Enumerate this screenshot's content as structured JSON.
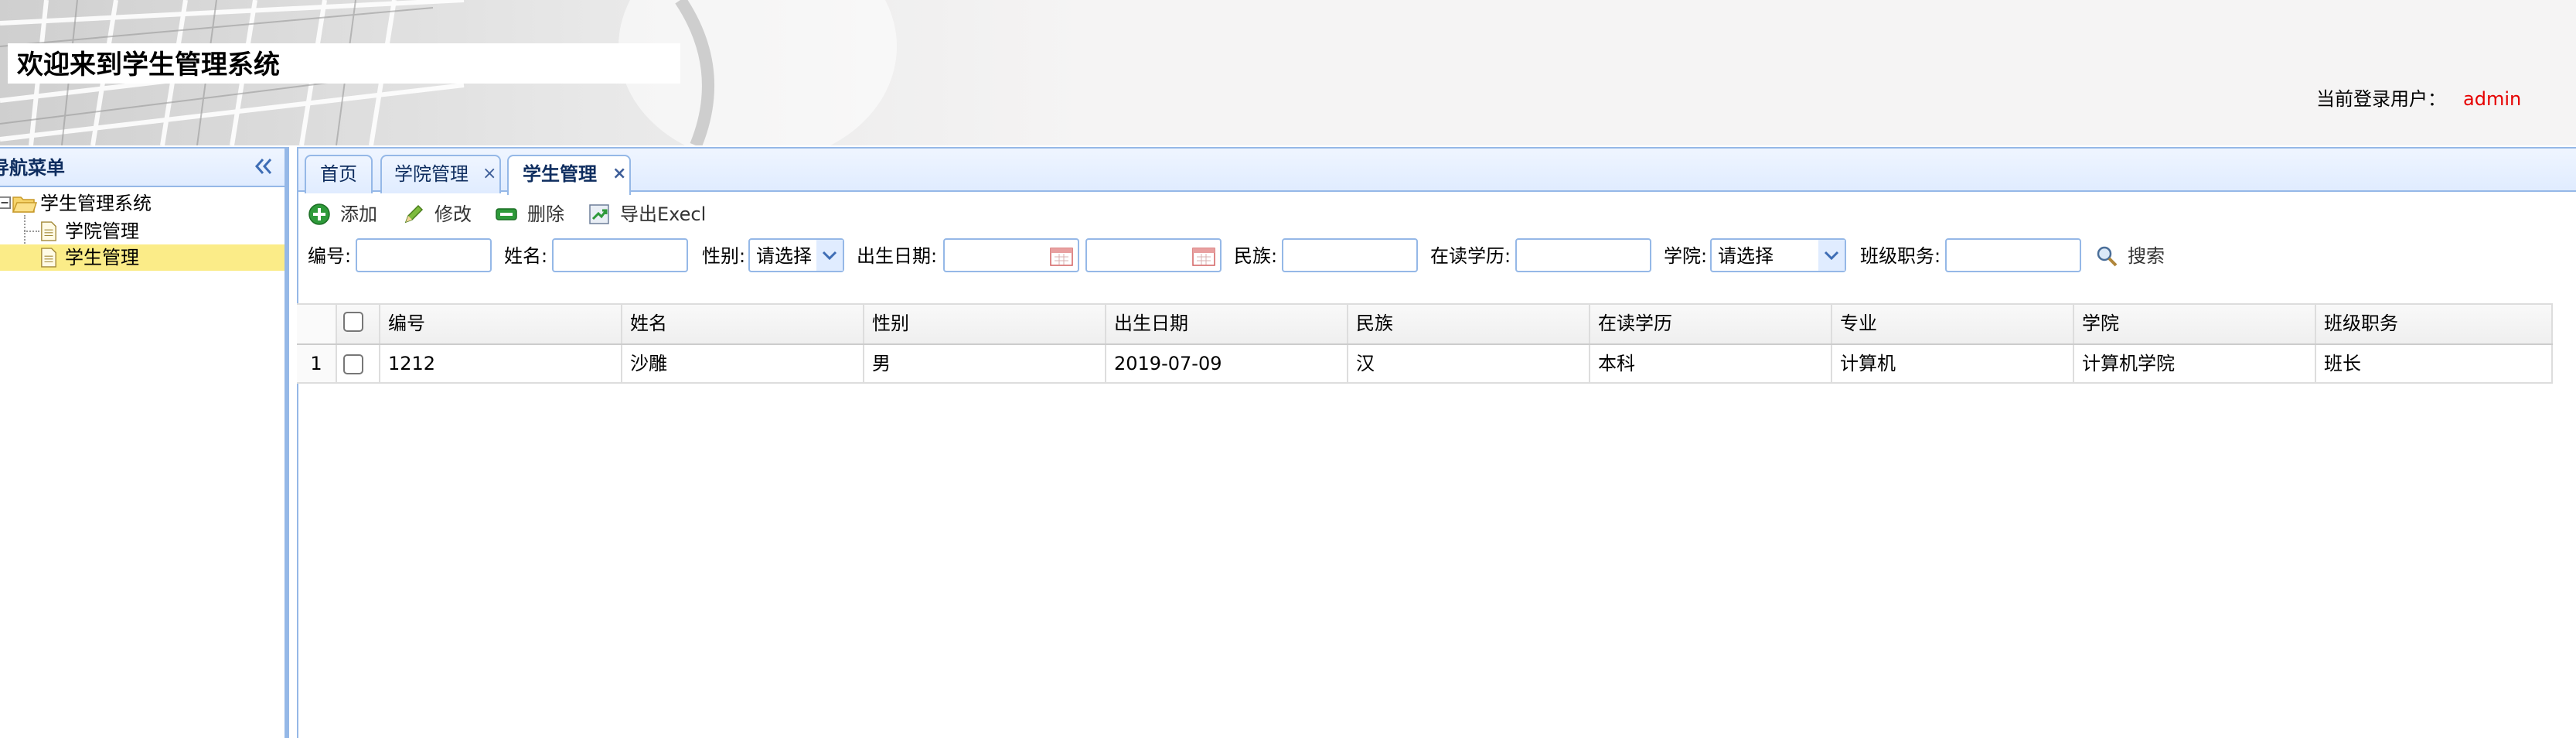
{
  "header": {
    "title": "欢迎来到学生管理系统",
    "user_label": "当前登录用户：",
    "user_name": "admin",
    "user_name_color": "#e60000"
  },
  "nav": {
    "title": "导航菜单",
    "tree": {
      "root": "学生管理系统",
      "children": [
        "学院管理",
        "学生管理"
      ],
      "selected": "学生管理"
    }
  },
  "tabs": [
    {
      "label": "首页",
      "closable": false,
      "active": false
    },
    {
      "label": "学院管理",
      "closable": true,
      "active": false
    },
    {
      "label": "学生管理",
      "closable": true,
      "active": true
    }
  ],
  "tab_close_glyph": "×",
  "toolbar": {
    "add": "添加",
    "edit": "修改",
    "delete": "删除",
    "export": "导出Execl"
  },
  "search": {
    "id_label": "编号:",
    "id_value": "",
    "name_label": "姓名:",
    "name_value": "",
    "gender_label": "性别:",
    "gender_selected": "请选择",
    "birth_label": "出生日期:",
    "birth_from": "",
    "birth_to": "",
    "ethnicity_label": "民族:",
    "ethnicity_value": "",
    "education_label": "在读学历:",
    "education_value": "",
    "college_label": "学院:",
    "college_selected": "请选择",
    "position_label": "班级职务:",
    "position_value": "",
    "search_button": "搜索"
  },
  "grid": {
    "columns": [
      "编号",
      "姓名",
      "性别",
      "出生日期",
      "民族",
      "在读学历",
      "专业",
      "学院",
      "班级职务"
    ],
    "rows": [
      {
        "row_number": "1",
        "cells": [
          "1212",
          "沙雕",
          "男",
          "2019-07-09",
          "汉",
          "本科",
          "计算机",
          "计算机学院",
          "班长"
        ]
      }
    ]
  },
  "colors": {
    "accent_border": "#95b8e7",
    "selected_row": "#fbec88",
    "nav_title": "#0e2d5f"
  }
}
